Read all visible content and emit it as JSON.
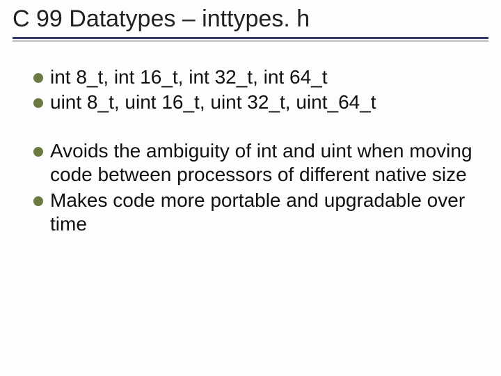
{
  "title": "C 99 Datatypes – inttypes. h",
  "group1": {
    "b1": "int 8_t, int 16_t, int 32_t, int 64_t",
    "b2": "uint 8_t, uint 16_t, uint 32_t, uint_64_t"
  },
  "group2": {
    "b1": "Avoids the ambiguity of int and uint when moving code between processors of different native size",
    "b2": "Makes code more portable and upgradable over time"
  }
}
